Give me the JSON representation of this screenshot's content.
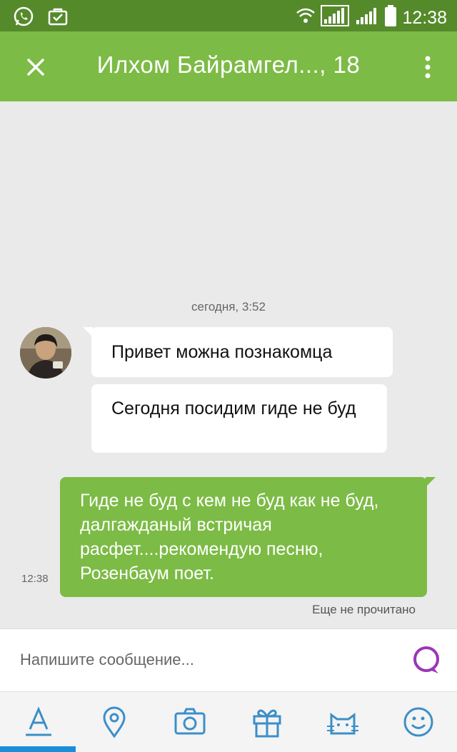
{
  "status": {
    "time": "12:38"
  },
  "header": {
    "title": "Илхом Байрамгел..., 18"
  },
  "chat": {
    "date_separator": "сегодня, 3:52",
    "incoming": [
      {
        "text": "Привет можна познакомца"
      },
      {
        "text": "Сегодня посидим гиде не буд"
      }
    ],
    "outgoing": {
      "text": "Гиде не буд с кем не буд как не буд, далгажданый встричая расфет....рекомендую песню, Розенбаум поет.",
      "time": "12:38",
      "status": "Еще не прочитано"
    }
  },
  "composer": {
    "placeholder": "Напишите сообщение..."
  },
  "toolbar": {
    "icons": [
      "text-format-icon",
      "location-icon",
      "camera-icon",
      "gift-icon",
      "cat-sticker-icon",
      "smiley-icon"
    ]
  },
  "colors": {
    "status_bar": "#558a2b",
    "app_bar": "#7cbb45",
    "outgoing_bubble": "#7cbb45",
    "send_icon": "#9b36b7",
    "tab_indicator": "#1a8fd8",
    "toolbar_icons": "#3c8fc8"
  }
}
